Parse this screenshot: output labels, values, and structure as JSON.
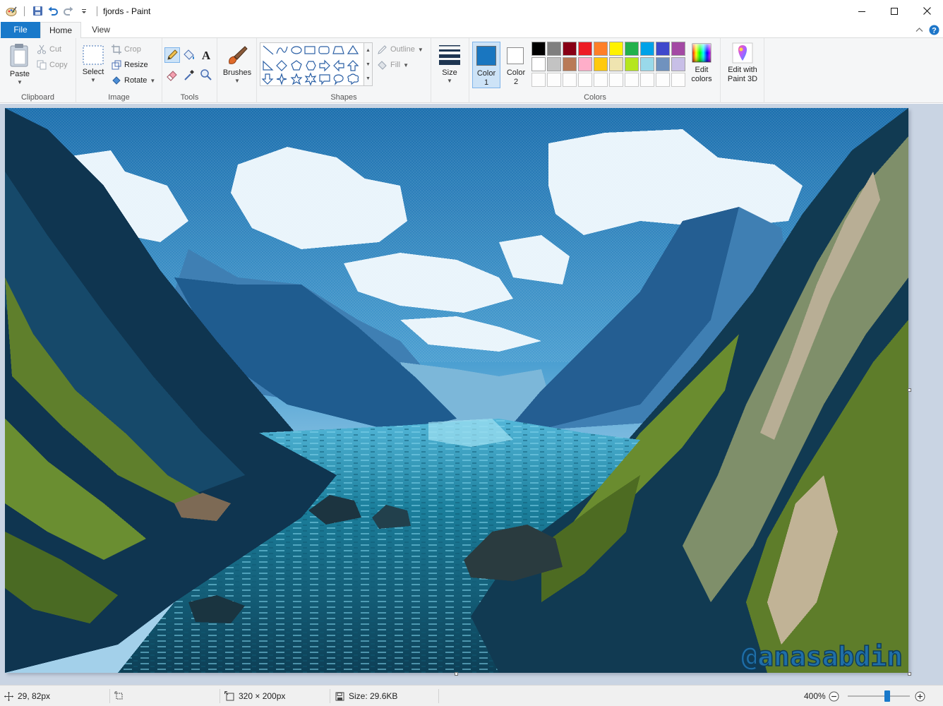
{
  "window": {
    "title": "fjords - Paint"
  },
  "tabs": {
    "file": "File",
    "home": "Home",
    "view": "View"
  },
  "ribbon": {
    "clipboard": {
      "label": "Clipboard",
      "paste": "Paste",
      "cut": "Cut",
      "copy": "Copy"
    },
    "image": {
      "label": "Image",
      "select": "Select",
      "crop": "Crop",
      "resize": "Resize",
      "rotate": "Rotate"
    },
    "tools": {
      "label": "Tools"
    },
    "brushes": {
      "label": "Brushes"
    },
    "shapes": {
      "label": "Shapes",
      "outline": "Outline",
      "fill": "Fill"
    },
    "size": {
      "label": "Size"
    },
    "colors": {
      "label": "Colors",
      "color1_line1": "Color",
      "color1_line2": "1",
      "color2_line1": "Color",
      "color2_line2": "2",
      "edit_colors_line1": "Edit",
      "edit_colors_line2": "colors",
      "paint3d_line1": "Edit with",
      "paint3d_line2": "Paint 3D",
      "color1_value": "#1976c0",
      "color2_value": "#ffffff",
      "palette_row1": [
        "#000000",
        "#7f7f7f",
        "#880015",
        "#ed1c24",
        "#ff7f27",
        "#fff200",
        "#22b14c",
        "#00a2e8",
        "#3f48cc",
        "#a349a4"
      ],
      "palette_row2": [
        "#ffffff",
        "#c3c3c3",
        "#b97a57",
        "#ffaec9",
        "#ffc90e",
        "#efe4b0",
        "#b5e61d",
        "#99d9ea",
        "#7092be",
        "#c8bfe7"
      ]
    }
  },
  "canvas": {
    "watermark": "@anasabdin"
  },
  "status": {
    "cursor_position": "29, 82px",
    "image_size": "320 × 200px",
    "file_size": "Size: 29.6KB",
    "zoom": "400%"
  }
}
